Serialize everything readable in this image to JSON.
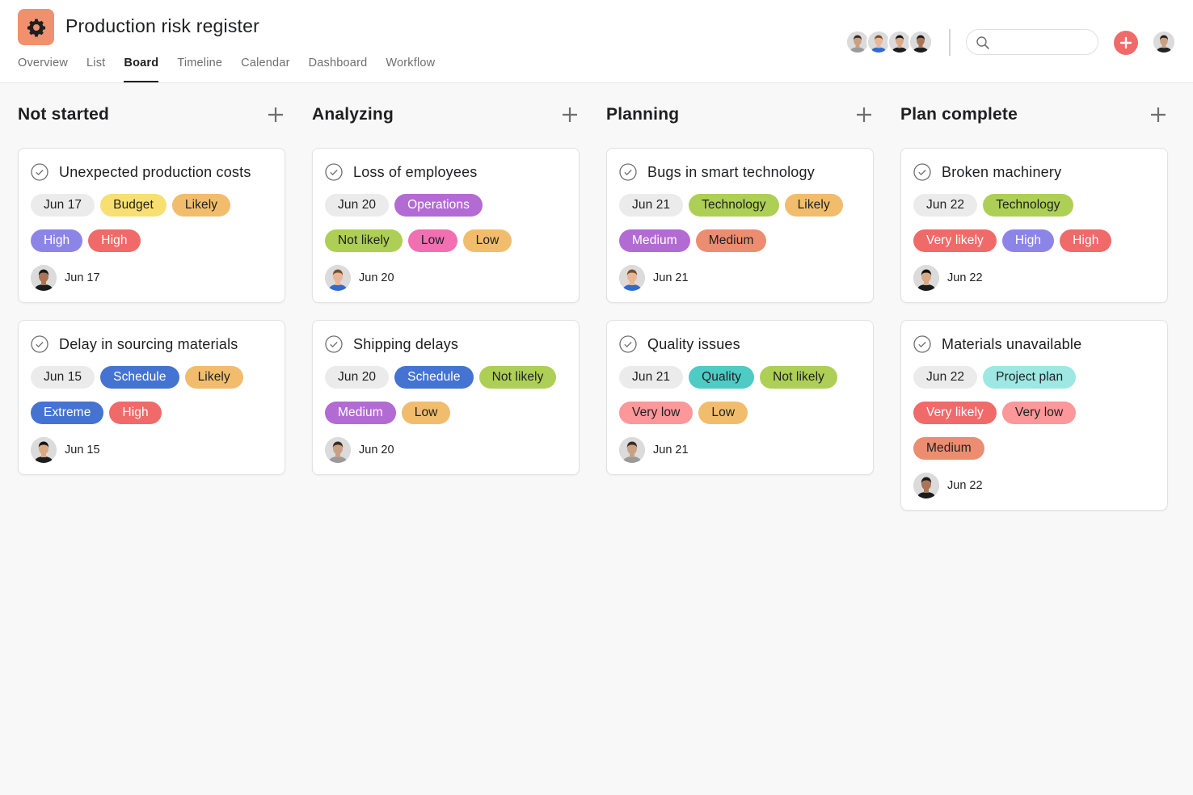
{
  "project": {
    "title": "Production risk register",
    "icon": "gear-icon",
    "icon_color": "#f0906e"
  },
  "tabs": [
    {
      "label": "Overview",
      "active": false
    },
    {
      "label": "List",
      "active": false
    },
    {
      "label": "Board",
      "active": true
    },
    {
      "label": "Timeline",
      "active": false
    },
    {
      "label": "Calendar",
      "active": false
    },
    {
      "label": "Dashboard",
      "active": false
    },
    {
      "label": "Workflow",
      "active": false
    }
  ],
  "members": [
    {
      "name": "member-1",
      "skin": "#c9a083",
      "hair": "#3b2a20",
      "shirt": "#9a9a9a"
    },
    {
      "name": "member-2",
      "skin": "#e6b899",
      "hair": "#7a4e2d",
      "shirt": "#2f6bd1"
    },
    {
      "name": "member-3",
      "skin": "#d9a884",
      "hair": "#141414",
      "shirt": "#1c1c1c"
    },
    {
      "name": "member-4",
      "skin": "#a97555",
      "hair": "#1a1a1a",
      "shirt": "#1c1c1c"
    }
  ],
  "search": {
    "placeholder": "",
    "value": ""
  },
  "colors": {
    "accent_red": "#f06a6a",
    "date_tag": "#ebebeb"
  },
  "columns": [
    {
      "title": "Not started",
      "cards": [
        {
          "title": "Unexpected production costs",
          "tag_rows": [
            [
              {
                "label": "Jun 17",
                "bg": "#ebebeb",
                "fg": "#1e1f21"
              },
              {
                "label": "Budget",
                "bg": "#f8df72",
                "fg": "#1e1f21"
              },
              {
                "label": "Likely",
                "bg": "#f1bd6c",
                "fg": "#1e1f21"
              }
            ],
            [
              {
                "label": "High",
                "bg": "#8d84e8",
                "fg": "#ffffff"
              },
              {
                "label": "High",
                "bg": "#f06a6a",
                "fg": "#ffffff"
              }
            ]
          ],
          "assignee": {
            "skin": "#a97555",
            "hair": "#1a1a1a",
            "shirt": "#1c1c1c"
          },
          "due": "Jun 17"
        },
        {
          "title": "Delay in sourcing materials",
          "tag_rows": [
            [
              {
                "label": "Jun 15",
                "bg": "#ebebeb",
                "fg": "#1e1f21"
              },
              {
                "label": "Schedule",
                "bg": "#4573d2",
                "fg": "#ffffff"
              },
              {
                "label": "Likely",
                "bg": "#f1bd6c",
                "fg": "#1e1f21"
              }
            ],
            [
              {
                "label": "Extreme",
                "bg": "#4573d2",
                "fg": "#ffffff"
              },
              {
                "label": "High",
                "bg": "#f06a6a",
                "fg": "#ffffff"
              }
            ]
          ],
          "assignee": {
            "skin": "#d9a884",
            "hair": "#141414",
            "shirt": "#1c1c1c"
          },
          "due": "Jun 15"
        }
      ]
    },
    {
      "title": "Analyzing",
      "cards": [
        {
          "title": "Loss of employees",
          "tag_rows": [
            [
              {
                "label": "Jun 20",
                "bg": "#ebebeb",
                "fg": "#1e1f21"
              },
              {
                "label": "Operations",
                "bg": "#b36bd4",
                "fg": "#ffffff"
              }
            ],
            [
              {
                "label": "Not likely",
                "bg": "#aecf55",
                "fg": "#1e1f21"
              },
              {
                "label": "Low",
                "bg": "#f26fb2",
                "fg": "#1e1f21"
              },
              {
                "label": "Low",
                "bg": "#f1bd6c",
                "fg": "#1e1f21"
              }
            ]
          ],
          "assignee": {
            "skin": "#e6b899",
            "hair": "#7a4e2d",
            "shirt": "#2f6bd1"
          },
          "due": "Jun 20"
        },
        {
          "title": "Shipping delays",
          "tag_rows": [
            [
              {
                "label": "Jun 20",
                "bg": "#ebebeb",
                "fg": "#1e1f21"
              },
              {
                "label": "Schedule",
                "bg": "#4573d2",
                "fg": "#ffffff"
              },
              {
                "label": "Not likely",
                "bg": "#aecf55",
                "fg": "#1e1f21"
              }
            ],
            [
              {
                "label": "Medium",
                "bg": "#b36bd4",
                "fg": "#ffffff"
              },
              {
                "label": "Low",
                "bg": "#f1bd6c",
                "fg": "#1e1f21"
              }
            ]
          ],
          "assignee": {
            "skin": "#c9a083",
            "hair": "#3b2a20",
            "shirt": "#9a9a9a"
          },
          "due": "Jun 20"
        }
      ]
    },
    {
      "title": "Planning",
      "cards": [
        {
          "title": "Bugs in smart technology",
          "tag_rows": [
            [
              {
                "label": "Jun 21",
                "bg": "#ebebeb",
                "fg": "#1e1f21"
              },
              {
                "label": "Technology",
                "bg": "#aecf55",
                "fg": "#1e1f21"
              },
              {
                "label": "Likely",
                "bg": "#f1bd6c",
                "fg": "#1e1f21"
              }
            ],
            [
              {
                "label": "Medium",
                "bg": "#b36bd4",
                "fg": "#ffffff"
              },
              {
                "label": "Medium",
                "bg": "#ec8d71",
                "fg": "#1e1f21"
              }
            ]
          ],
          "assignee": {
            "skin": "#e6b899",
            "hair": "#7a4e2d",
            "shirt": "#2f6bd1"
          },
          "due": "Jun 21"
        },
        {
          "title": "Quality issues",
          "tag_rows": [
            [
              {
                "label": "Jun 21",
                "bg": "#ebebeb",
                "fg": "#1e1f21"
              },
              {
                "label": "Quality",
                "bg": "#4ecbc4",
                "fg": "#1e1f21"
              },
              {
                "label": "Not likely",
                "bg": "#aecf55",
                "fg": "#1e1f21"
              }
            ],
            [
              {
                "label": "Very low",
                "bg": "#fc979a",
                "fg": "#1e1f21"
              },
              {
                "label": "Low",
                "bg": "#f1bd6c",
                "fg": "#1e1f21"
              }
            ]
          ],
          "assignee": {
            "skin": "#c9a083",
            "hair": "#3b2a20",
            "shirt": "#9a9a9a"
          },
          "due": "Jun 21"
        }
      ]
    },
    {
      "title": "Plan complete",
      "cards": [
        {
          "title": "Broken machinery",
          "tag_rows": [
            [
              {
                "label": "Jun 22",
                "bg": "#ebebeb",
                "fg": "#1e1f21"
              },
              {
                "label": "Technology",
                "bg": "#aecf55",
                "fg": "#1e1f21"
              }
            ],
            [
              {
                "label": "Very likely",
                "bg": "#f06a6a",
                "fg": "#ffffff"
              },
              {
                "label": "High",
                "bg": "#8d84e8",
                "fg": "#ffffff"
              },
              {
                "label": "High",
                "bg": "#f06a6a",
                "fg": "#ffffff"
              }
            ]
          ],
          "assignee": {
            "skin": "#d9a884",
            "hair": "#141414",
            "shirt": "#1c1c1c"
          },
          "due": "Jun 22"
        },
        {
          "title": "Materials unavailable",
          "tag_rows": [
            [
              {
                "label": "Jun 22",
                "bg": "#ebebeb",
                "fg": "#1e1f21"
              },
              {
                "label": "Project plan",
                "bg": "#9ee7e3",
                "fg": "#1e1f21"
              }
            ],
            [
              {
                "label": "Very likely",
                "bg": "#f06a6a",
                "fg": "#ffffff"
              },
              {
                "label": "Very low",
                "bg": "#fc979a",
                "fg": "#1e1f21"
              }
            ],
            [
              {
                "label": "Medium",
                "bg": "#ec8d71",
                "fg": "#1e1f21"
              }
            ]
          ],
          "assignee": {
            "skin": "#a97555",
            "hair": "#1a1a1a",
            "shirt": "#1c1c1c"
          },
          "due": "Jun 22"
        }
      ]
    }
  ],
  "current_user": {
    "skin": "#c9a083",
    "hair": "#2a1d15",
    "shirt": "#222222"
  }
}
